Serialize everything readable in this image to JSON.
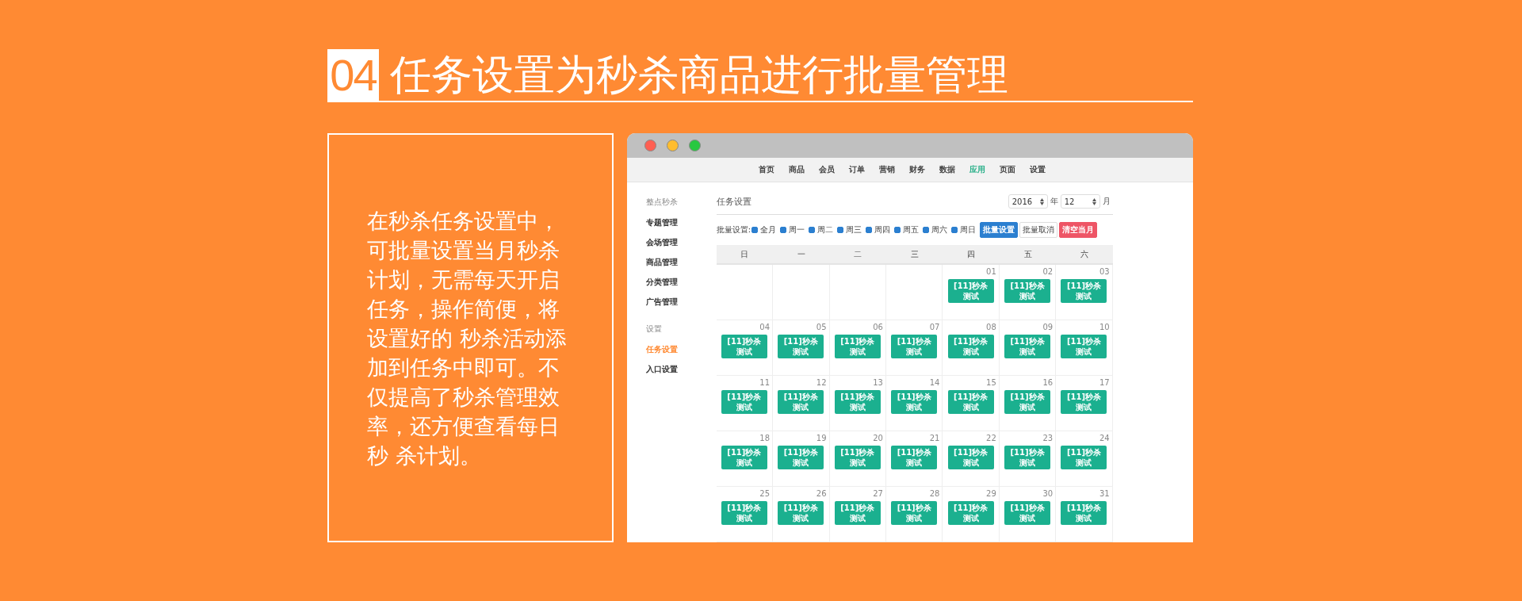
{
  "heading": {
    "number": "04",
    "title": "任务设置为秒杀商品进行批量管理"
  },
  "description": "在秒杀任务设置中，可批量设置当月秒杀计划，无需每天开启任务，操作简便，将设置好的 秒杀活动添加到任务中即可。不仅提高了秒杀管理效率，还方便查看每日秒 杀计划。",
  "nav": [
    {
      "label": "首页",
      "selected": false
    },
    {
      "label": "商品",
      "selected": false
    },
    {
      "label": "会员",
      "selected": false
    },
    {
      "label": "订单",
      "selected": false
    },
    {
      "label": "营销",
      "selected": false
    },
    {
      "label": "财务",
      "selected": false
    },
    {
      "label": "数据",
      "selected": false
    },
    {
      "label": "应用",
      "selected": true
    },
    {
      "label": "页面",
      "selected": false
    },
    {
      "label": "设置",
      "selected": false
    }
  ],
  "sidebar": [
    {
      "title": "整点秒杀",
      "items": [
        {
          "label": "专题管理",
          "selected": false
        },
        {
          "label": "会场管理",
          "selected": false
        },
        {
          "label": "商品管理",
          "selected": false
        },
        {
          "label": "分类管理",
          "selected": false
        },
        {
          "label": "广告管理",
          "selected": false
        }
      ]
    },
    {
      "title": "设置",
      "items": [
        {
          "label": "任务设置",
          "selected": true
        },
        {
          "label": "入口设置",
          "selected": false
        }
      ]
    }
  ],
  "page_title": "任务设置",
  "year": {
    "value": "2016",
    "unit": "年"
  },
  "month": {
    "value": "12",
    "unit": "月"
  },
  "batch": {
    "label": "批量设置:",
    "options": [
      {
        "label": "全月",
        "checked": true
      },
      {
        "label": "周一",
        "checked": true
      },
      {
        "label": "周二",
        "checked": true
      },
      {
        "label": "周三",
        "checked": true
      },
      {
        "label": "周四",
        "checked": true
      },
      {
        "label": "周五",
        "checked": true
      },
      {
        "label": "周六",
        "checked": true
      },
      {
        "label": "周日",
        "checked": true
      }
    ],
    "buttons": [
      {
        "label": "批量设置",
        "kind": "primary"
      },
      {
        "label": "批量取消",
        "kind": "default"
      },
      {
        "label": "清空当月",
        "kind": "danger"
      }
    ]
  },
  "calendar": {
    "weekdays": [
      "日",
      "一",
      "二",
      "三",
      "四",
      "五",
      "六"
    ],
    "days": [
      {
        "kind": "blank"
      },
      {
        "kind": "blank"
      },
      {
        "kind": "blank"
      },
      {
        "kind": "blank"
      },
      {
        "kind": "day",
        "date": "01",
        "event": "[11]秒杀测试"
      },
      {
        "kind": "day",
        "date": "02",
        "event": "[11]秒杀测试"
      },
      {
        "kind": "day",
        "date": "03",
        "event": "[11]秒杀测试"
      },
      {
        "kind": "day",
        "date": "04",
        "event": "[11]秒杀测试"
      },
      {
        "kind": "day",
        "date": "05",
        "event": "[11]秒杀测试"
      },
      {
        "kind": "day",
        "date": "06",
        "event": "[11]秒杀测试"
      },
      {
        "kind": "day",
        "date": "07",
        "event": "[11]秒杀测试"
      },
      {
        "kind": "day",
        "date": "08",
        "event": "[11]秒杀测试"
      },
      {
        "kind": "day",
        "date": "09",
        "event": "[11]秒杀测试"
      },
      {
        "kind": "day",
        "date": "10",
        "event": "[11]秒杀测试"
      },
      {
        "kind": "day",
        "date": "11",
        "event": "[11]秒杀测试"
      },
      {
        "kind": "day",
        "date": "12",
        "event": "[11]秒杀测试"
      },
      {
        "kind": "day",
        "date": "13",
        "event": "[11]秒杀测试"
      },
      {
        "kind": "day",
        "date": "14",
        "event": "[11]秒杀测试"
      },
      {
        "kind": "day",
        "date": "15",
        "event": "[11]秒杀测试"
      },
      {
        "kind": "day",
        "date": "16",
        "event": "[11]秒杀测试"
      },
      {
        "kind": "day",
        "date": "17",
        "event": "[11]秒杀测试"
      },
      {
        "kind": "day",
        "date": "18",
        "event": "[11]秒杀测试"
      },
      {
        "kind": "day",
        "date": "19",
        "event": "[11]秒杀测试"
      },
      {
        "kind": "day",
        "date": "20",
        "event": "[11]秒杀测试"
      },
      {
        "kind": "day",
        "date": "21",
        "event": "[11]秒杀测试"
      },
      {
        "kind": "day",
        "date": "22",
        "event": "[11]秒杀测试"
      },
      {
        "kind": "day",
        "date": "23",
        "event": "[11]秒杀测试"
      },
      {
        "kind": "day",
        "date": "24",
        "event": "[11]秒杀测试"
      },
      {
        "kind": "day",
        "date": "25",
        "event": "[11]秒杀测试"
      },
      {
        "kind": "day",
        "date": "26",
        "event": "[11]秒杀测试"
      },
      {
        "kind": "day",
        "date": "27",
        "event": "[11]秒杀测试"
      },
      {
        "kind": "day",
        "date": "28",
        "event": "[11]秒杀测试"
      },
      {
        "kind": "day",
        "date": "29",
        "event": "[11]秒杀测试"
      },
      {
        "kind": "day",
        "date": "30",
        "event": "[11]秒杀测试"
      },
      {
        "kind": "day",
        "date": "31",
        "event": "[11]秒杀测试"
      }
    ]
  }
}
